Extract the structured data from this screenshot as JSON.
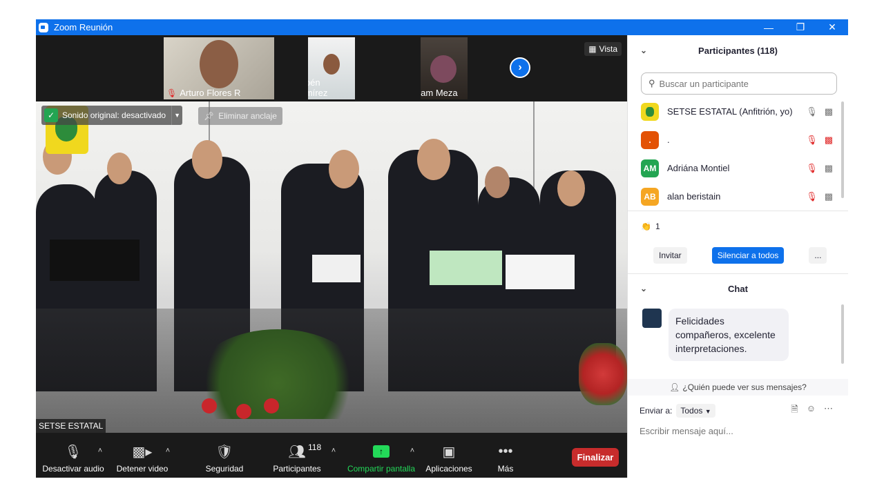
{
  "window": {
    "title": "Zoom Reunión",
    "minimize_icon": "minimize-icon",
    "restore_icon": "restore-icon",
    "close_icon": "close-icon"
  },
  "thumbnails": [
    {
      "name": "Arturo Flores R",
      "muted": true
    },
    {
      "name": "Rubén Ramírez",
      "muted": true
    },
    {
      "name": "Miriam Meza",
      "muted": true
    }
  ],
  "view": {
    "label": "Vista"
  },
  "main_video": {
    "sound_badge": "Sonido original: desactivado",
    "unpin_label": "Eliminar anclaje",
    "speaker_name": "SETSE ESTATAL"
  },
  "toolbar": {
    "audio": "Desactivar audio",
    "video": "Detener video",
    "security": "Seguridad",
    "participants": "Participantes",
    "participants_count": "118",
    "share": "Compartir pantalla",
    "apps": "Aplicaciones",
    "more": "Más",
    "end": "Finalizar"
  },
  "participants_panel": {
    "title": "Participantes (118)",
    "search_placeholder": "Buscar un participante",
    "list": [
      {
        "initials": "",
        "name": "SETSE ESTATAL (Anfitrión, yo)",
        "color": "#f0d81e",
        "mic_off": false,
        "cam_off": false
      },
      {
        "initials": ".",
        "name": ".",
        "color": "#e35205",
        "mic_off": true,
        "cam_off": true
      },
      {
        "initials": "AM",
        "name": "Adriána Montiel",
        "color": "#23a552",
        "mic_off": true,
        "cam_off": false
      },
      {
        "initials": "AB",
        "name": "alan beristain",
        "color": "#f5a623",
        "mic_off": true,
        "cam_off": false
      }
    ],
    "reaction_count": "1",
    "invite": "Invitar",
    "mute_all": "Silenciar a todos",
    "more": "..."
  },
  "chat": {
    "title": "Chat",
    "message": "Felicidades compañeros, excelente interpretaciones.",
    "who_sees": "¿Quién puede ver sus mensajes?",
    "send_to_label": "Enviar a:",
    "send_to_value": "Todos",
    "input_placeholder": "Escribir mensaje aquí..."
  },
  "colors": {
    "accent": "#0e71eb",
    "danger": "#c72c2c",
    "share": "#23d959"
  }
}
